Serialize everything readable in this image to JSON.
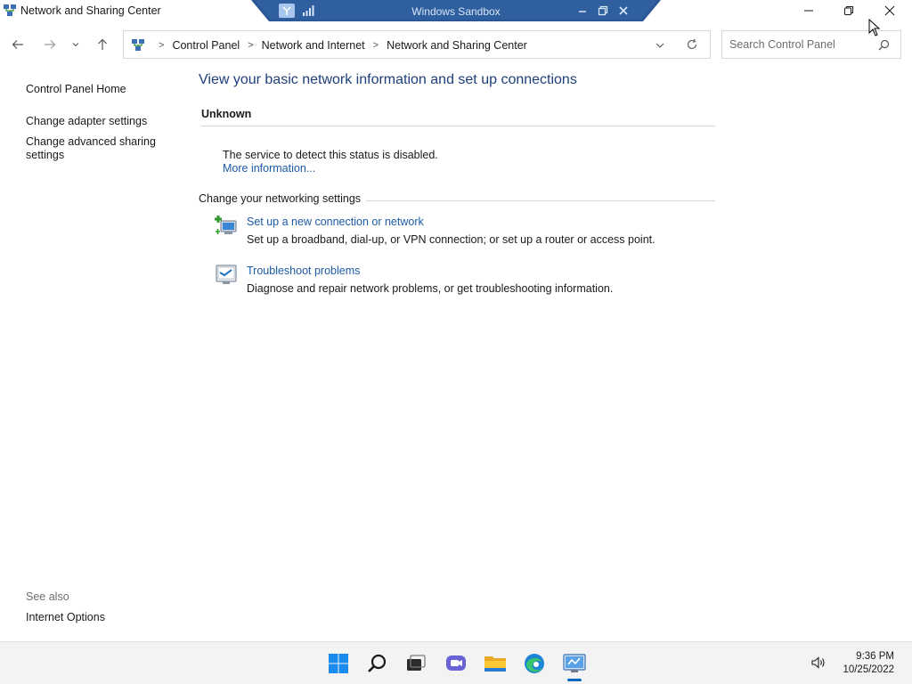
{
  "window": {
    "title": "Network and Sharing Center"
  },
  "sandbox": {
    "title": "Windows Sandbox"
  },
  "address": {
    "breadcrumbs": [
      "Control Panel",
      "Network and Internet",
      "Network and Sharing Center"
    ],
    "search_placeholder": "Search Control Panel"
  },
  "sidebar": {
    "home": "Control Panel Home",
    "adapter": "Change adapter settings",
    "advanced_line1": "Change advanced sharing",
    "advanced_line2": "settings",
    "see_also": "See also",
    "internet_options": "Internet Options"
  },
  "main": {
    "heading": "View your basic network information and set up connections",
    "network_name": "Unknown",
    "status_text": "The service to detect this status is disabled.",
    "more_info": "More information...",
    "change_heading": "Change your networking settings",
    "tasks": [
      {
        "link": "Set up a new connection or network",
        "desc": "Set up a broadband, dial-up, or VPN connection; or set up a router or access point.",
        "icon": "new-connection-icon"
      },
      {
        "link": "Troubleshoot problems",
        "desc": "Diagnose and repair network problems, or get troubleshooting information.",
        "icon": "troubleshoot-icon"
      }
    ]
  },
  "taskbar": {
    "time": "9:36 PM",
    "date": "10/25/2022",
    "icons": [
      "start-icon",
      "search-icon",
      "task-view-icon",
      "chat-icon",
      "file-explorer-icon",
      "edge-icon",
      "control-panel-icon"
    ]
  },
  "colors": {
    "link": "#1c5aa5",
    "heading": "#1e3f7a",
    "sandbox_banner": "#2b5797",
    "accent": "#0067c0"
  }
}
